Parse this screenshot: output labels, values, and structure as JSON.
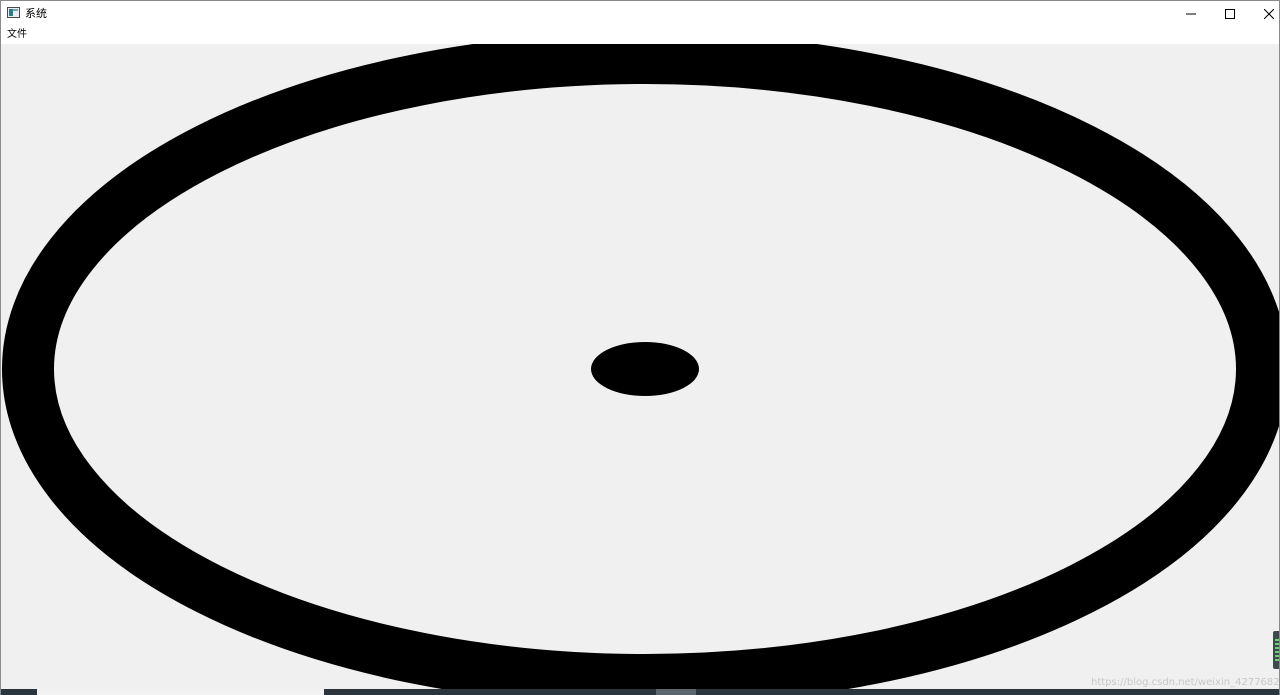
{
  "window": {
    "title": "系统",
    "icon": "app-window-icon"
  },
  "controls": {
    "minimize_icon": "minimize-icon",
    "maximize_icon": "maximize-icon",
    "close_icon": "close-icon"
  },
  "menu": {
    "items": [
      "文件"
    ]
  },
  "canvas": {
    "background": "#f0f0f0",
    "shape_color": "#000000"
  },
  "watermark": "https://blog.csdn.net/weixin_42776820"
}
